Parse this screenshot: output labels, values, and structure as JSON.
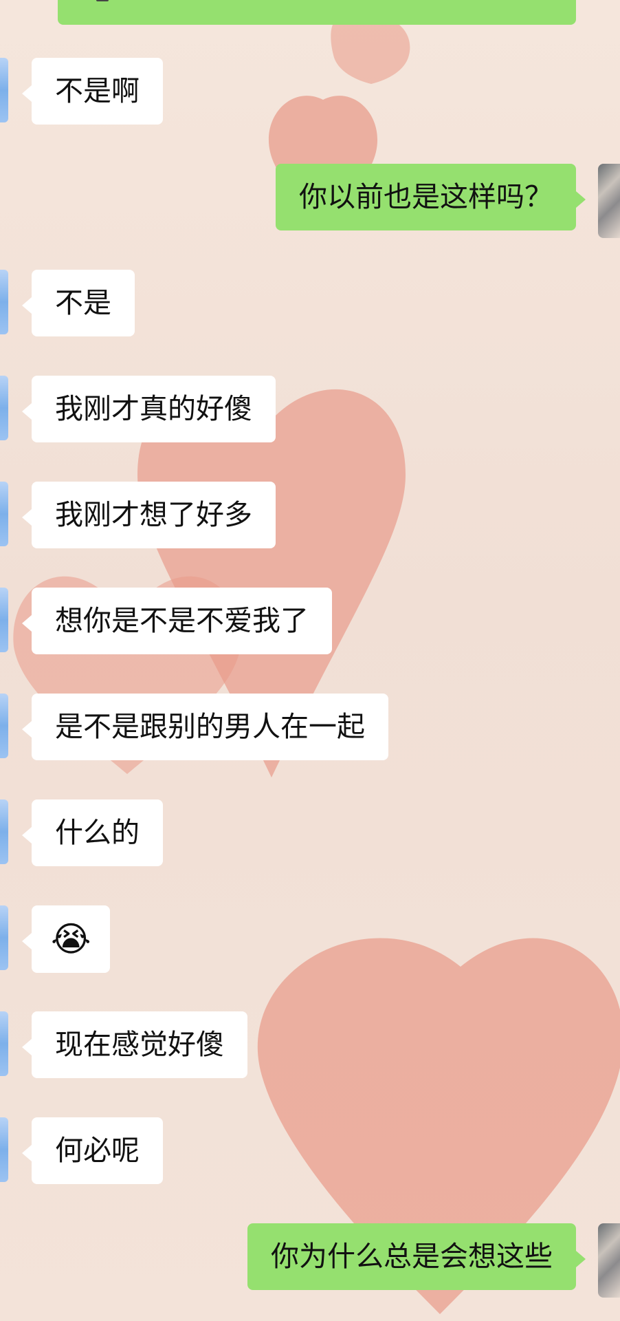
{
  "chat": {
    "messages": [
      {
        "side": "left",
        "text": "不是啊"
      },
      {
        "side": "right",
        "text": "你以前也是这样吗？"
      },
      {
        "side": "left",
        "text": "不是"
      },
      {
        "side": "left",
        "text": "我刚才真的好傻"
      },
      {
        "side": "left",
        "text": "我刚才想了好多"
      },
      {
        "side": "left",
        "text": "想你是不是不爱我了"
      },
      {
        "side": "left",
        "text": "是不是跟别的男人在一起"
      },
      {
        "side": "left",
        "text": "什么的"
      },
      {
        "side": "left",
        "emoji": "😭"
      },
      {
        "side": "left",
        "text": "现在感觉好傻"
      },
      {
        "side": "left",
        "text": "何必呢"
      },
      {
        "side": "right",
        "text": "你为什么总是会想这些"
      }
    ]
  },
  "colors": {
    "background": "#f3e0d5",
    "bubble_left": "#ffffff",
    "bubble_right": "#95e06f",
    "heart": "#e89a89"
  },
  "icons": {
    "wallpaper": "heart-icon"
  }
}
